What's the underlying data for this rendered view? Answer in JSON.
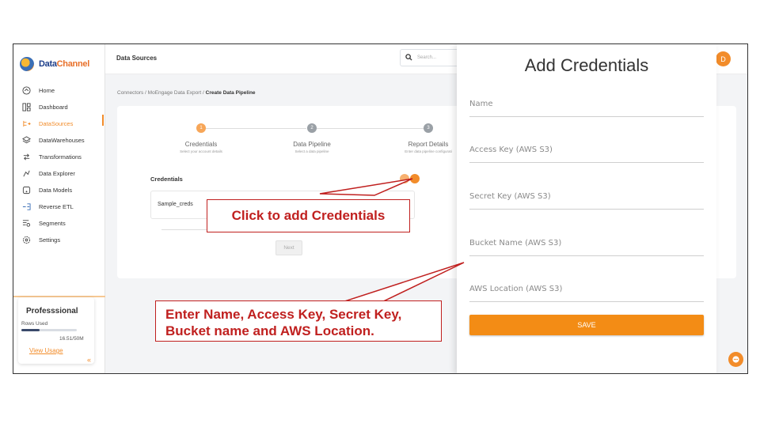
{
  "brand": {
    "name_part1": "Data",
    "name_part2": "Channel"
  },
  "sidebar": {
    "items": [
      {
        "label": "Home",
        "icon": "home-icon"
      },
      {
        "label": "Dashboard",
        "icon": "dashboard-icon"
      },
      {
        "label": "DataSources",
        "icon": "datasources-icon",
        "active": true
      },
      {
        "label": "DataWarehouses",
        "icon": "warehouse-icon"
      },
      {
        "label": "Transformations",
        "icon": "transform-icon"
      },
      {
        "label": "Data Explorer",
        "icon": "explorer-icon"
      },
      {
        "label": "Data Models",
        "icon": "models-icon"
      },
      {
        "label": "Reverse ETL",
        "icon": "reverse-etl-icon"
      },
      {
        "label": "Segments",
        "icon": "segments-icon"
      },
      {
        "label": "Settings",
        "icon": "settings-icon"
      }
    ],
    "plan": {
      "title": "Professsional",
      "rows_label": "Rows Used",
      "count": "16.51/50M",
      "usage_fraction": 0.33,
      "link": "View Usage"
    }
  },
  "header": {
    "title": "Data Sources",
    "search_placeholder": "Search...",
    "avatar_initial": "D"
  },
  "breadcrumb": {
    "part1": "Connectors",
    "sep1": " / ",
    "part2": "MoEngage Data Export",
    "sep2": " / ",
    "current": "Create Data Pipeline"
  },
  "steps": [
    {
      "num": "1",
      "label": "Credentials",
      "sub": "Select your account details"
    },
    {
      "num": "2",
      "label": "Data Pipeline",
      "sub": "Select a data pipeline"
    },
    {
      "num": "3",
      "label": "Report Details",
      "sub": "Enter data pipeline configurati"
    }
  ],
  "credentials": {
    "heading": "Credentials",
    "row_name": "Sample_creds",
    "next_label": "Next"
  },
  "panel": {
    "title": "Add Credentials",
    "fields": [
      "Name",
      "Access Key (AWS S3)",
      "Secret Key (AWS S3)",
      "Bucket Name (AWS S3)",
      "AWS Location (AWS S3)"
    ],
    "save_label": "SAVE"
  },
  "callouts": {
    "add": "Click to add Credentials",
    "enter_line1": "Enter Name, Access Key, Secret Key,",
    "enter_line2": "Bucket name and AWS Location."
  },
  "colors": {
    "accent": "#f28c2a",
    "callout": "#c0201f",
    "save": "#f38c15"
  }
}
